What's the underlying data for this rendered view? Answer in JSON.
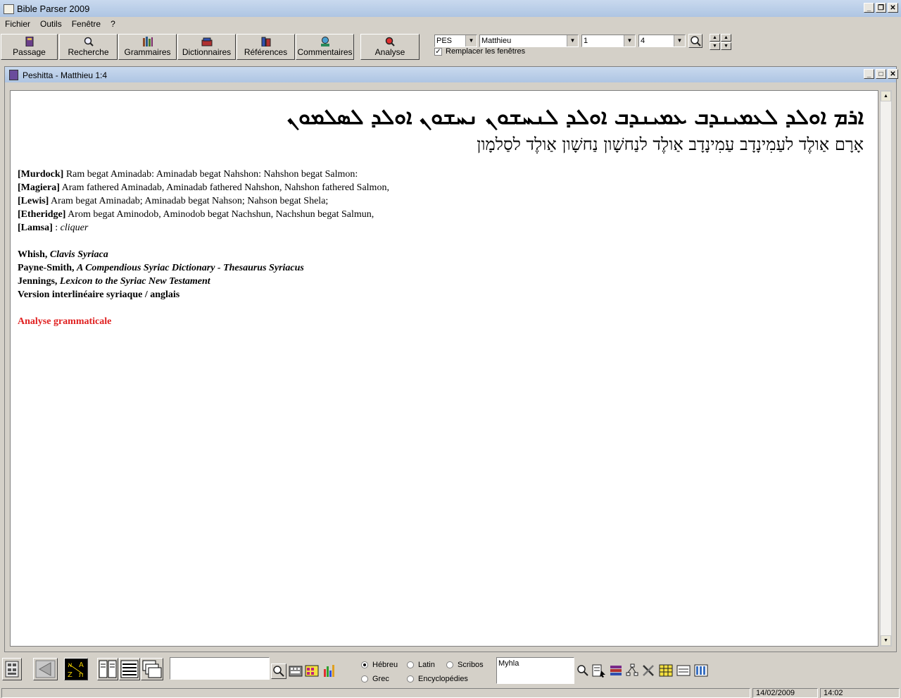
{
  "app": {
    "title": "Bible Parser 2009"
  },
  "menu": [
    "Fichier",
    "Outils",
    "Fenêtre",
    "?"
  ],
  "toolbar": {
    "buttons": [
      "Passage",
      "Recherche",
      "Grammaires",
      "Dictionnaires",
      "Références",
      "Commentaires"
    ],
    "analyse": "Analyse"
  },
  "selectors": {
    "version": "PES",
    "book": "Matthieu",
    "chapter": "1",
    "verse": "4"
  },
  "replace_windows": {
    "label": "Remplacer les fenêtres",
    "checked": true
  },
  "child_window": {
    "title": "Peshitta - Matthieu 1:4"
  },
  "verse": {
    "syriac": "ܐܪܡ ܐܘܠܕ ܠܥܡܝܢܕܒ ܥܡܝܢܕܒ ܐܘܠܕ ܠܢܚܫܘܢ ܢܚܫܘܢ ܐܘܠܕ ܠܣܠܡܘܢ",
    "hebrew": "אָרָם אַולֶד לעַמִינָדָב עַמִינָדָב אַולֶד לנַחשָׁון נַחשָׁון אַולֶד לסַלמָון"
  },
  "translations": [
    {
      "source": "[Murdock]",
      "text": " Ram begat Aminadab: Aminadab begat Nahshon: Nahshon begat Salmon:"
    },
    {
      "source": "[Magiera]",
      "text": " Aram fathered Aminadab, Aminadab fathered Nahshon, Nahshon fathered Salmon,"
    },
    {
      "source": "[Lewis]",
      "text": " Aram begat Aminadab; Aminadab begat Nahson; Nahson begat Shela;"
    },
    {
      "source": "[Etheridge]",
      "text": " Arom begat Aminodob, Aminodob begat Nachshun, Nachshun begat Salmun,"
    },
    {
      "source": "[Lamsa]",
      "sep": " : ",
      "link": "cliquer"
    }
  ],
  "references": [
    {
      "author": "Whish, ",
      "work": "Clavis Syriaca"
    },
    {
      "author": "Payne-Smith, ",
      "work": "A Compendious Syriac Dictionary - Thesaurus Syriacus"
    },
    {
      "author": "Jennings, ",
      "work": "Lexicon to the Syriac New Testament"
    },
    {
      "author": "Version interlinéaire syriaque / anglais",
      "work": ""
    }
  ],
  "analysis_link": "Analyse grammaticale",
  "analysis_link_color": "#e02020",
  "bottom": {
    "radios": [
      {
        "label": "Hébreu",
        "checked": true
      },
      {
        "label": "Latin",
        "checked": false
      },
      {
        "label": "Scribos",
        "checked": false
      },
      {
        "label": "Grec",
        "checked": false
      },
      {
        "label": "Encyclopédies",
        "checked": false
      }
    ],
    "lexicon_box": "Myhla"
  },
  "status": {
    "date": "14/02/2009",
    "time": "14:02"
  }
}
